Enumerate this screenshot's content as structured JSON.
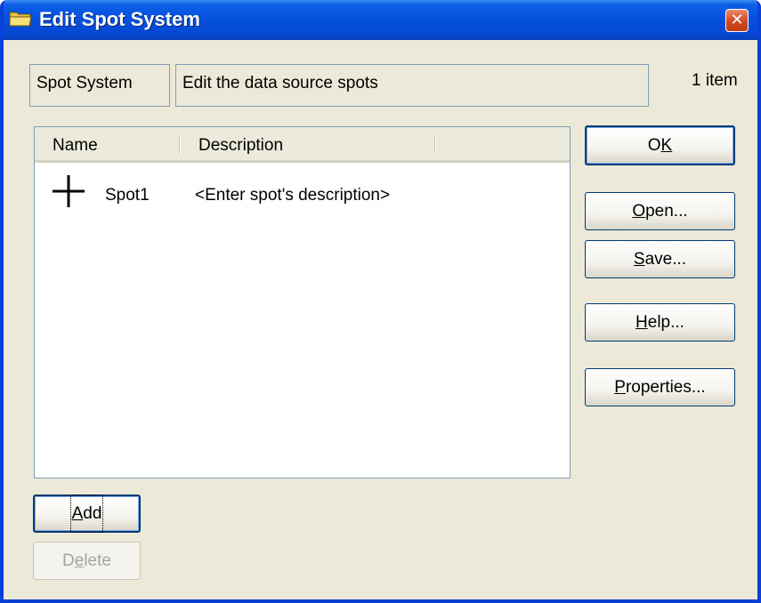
{
  "window": {
    "title": "Edit Spot System",
    "icon": "folder-icon",
    "close_glyph": "✕"
  },
  "header": {
    "name_box": "Spot System",
    "desc_box": "Edit the data source spots",
    "item_count": "1 item"
  },
  "list": {
    "columns": [
      "Name",
      "Description"
    ],
    "rows": [
      {
        "icon": "crosshair-icon",
        "name": "Spot1",
        "description": "<Enter spot's description>"
      }
    ]
  },
  "buttons": {
    "ok": {
      "label": "OK",
      "mnemonic": "K"
    },
    "open": {
      "label": "Open...",
      "mnemonic": "O"
    },
    "save": {
      "label": "Save...",
      "mnemonic": "S"
    },
    "help": {
      "label": "Help...",
      "mnemonic": "H"
    },
    "properties": {
      "label": "Properties...",
      "mnemonic": "P"
    },
    "add": {
      "label": "Add",
      "mnemonic": "A"
    },
    "delete": {
      "label": "Delete",
      "mnemonic": "e",
      "disabled": true
    }
  }
}
